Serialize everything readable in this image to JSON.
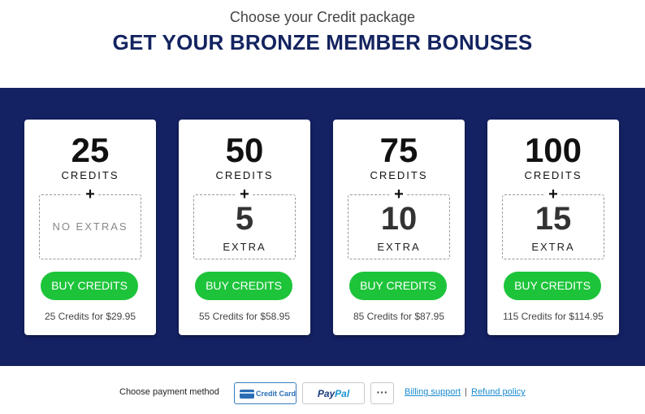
{
  "header": {
    "subtitle": "Choose your Credit package",
    "title": "GET YOUR BRONZE MEMBER BONUSES"
  },
  "packages": [
    {
      "credits": "25",
      "unit": "CREDITS",
      "extra": "",
      "extra_label": "",
      "no_extras": "NO EXTRAS",
      "button": "BUY CREDITS",
      "price": "25 Credits for $29.95"
    },
    {
      "credits": "50",
      "unit": "CREDITS",
      "extra": "5",
      "extra_label": "EXTRA",
      "button": "BUY CREDITS",
      "price": "55 Credits for $58.95"
    },
    {
      "credits": "75",
      "unit": "CREDITS",
      "extra": "10",
      "extra_label": "EXTRA",
      "button": "BUY CREDITS",
      "price": "85 Credits for $87.95"
    },
    {
      "credits": "100",
      "unit": "CREDITS",
      "extra": "15",
      "extra_label": "EXTRA",
      "button": "BUY CREDITS",
      "price": "115 Credits for $114.95"
    }
  ],
  "plus_symbol": "+",
  "footer": {
    "payment_label": "Choose payment method",
    "credit_card": "Credit Card",
    "paypal_a": "Pay",
    "paypal_b": "Pal",
    "more": "···",
    "billing_support": "Billing support",
    "separator": "|",
    "refund_policy": "Refund policy"
  },
  "colors": {
    "band": "#142264",
    "title": "#142460",
    "button": "#1dc43a",
    "link": "#1a8bd1"
  }
}
